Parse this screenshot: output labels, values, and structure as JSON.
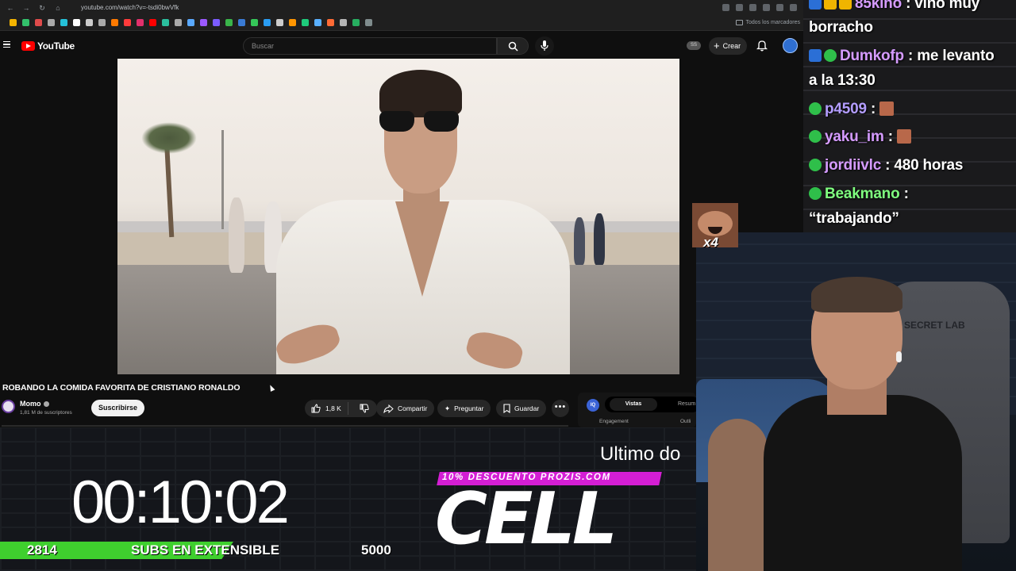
{
  "browser": {
    "url": "youtube.com/watch?v=-tsdi0bwVfk",
    "bookmarks_folder": "Todos los marcadores"
  },
  "youtube": {
    "logo_text": "YouTube",
    "search_placeholder": "Buscar",
    "ss_badge": "SS",
    "create_label": "Crear",
    "video_title": "ROBANDO LA COMIDA FAVORITA DE CRISTIANO RONALDO",
    "channel_name": "Momo",
    "channel_subs": "1,81 M de suscriptores",
    "subscribe_label": "Suscribirse",
    "like_count": "1,8 K",
    "share_label": "Compartir",
    "ask_label": "Preguntar",
    "save_label": "Guardar",
    "more_label": "•••",
    "analytics": {
      "icon_text": "IQ",
      "tab_active": "Vistas",
      "tab_inactive": "Resum",
      "row_left": "Engagement",
      "row_right": "Outli"
    }
  },
  "chat": [
    {
      "user": "85kino",
      "message": " : vino muy",
      "user_color": "#d59bff"
    },
    {
      "user": "",
      "message": "borracho",
      "user_color": "#ffffff"
    },
    {
      "user": "Dumkofp",
      "message": " : me levanto",
      "user_color": "#d59bff"
    },
    {
      "user": "",
      "message": "a la 13:30",
      "user_color": "#ffffff"
    },
    {
      "user": "p4509",
      "message": " : ",
      "user_color": "#b39dff"
    },
    {
      "user": "yaku_im",
      "message": " : ",
      "user_color": "#d59bff"
    },
    {
      "user": "jordiivlc",
      "message": " : 480 horas",
      "user_color": "#d59bff"
    },
    {
      "user": "Beakmano",
      "message": " :",
      "user_color": "#7fff7f"
    },
    {
      "user": "",
      "message": "“trabajando”",
      "user_color": "#ffffff"
    }
  ],
  "gif_overlay": {
    "multiplier": "x4"
  },
  "stream": {
    "timer": "00:10:02",
    "subs_current": "2814",
    "subs_label": "SUBS EN EXTENSIBLE",
    "subs_goal": "5000",
    "subs_progress_fraction": 0.563,
    "ultimo_text": "Ultimo do",
    "promo_text": "10% DESCUENTO PROZIS.COM",
    "brand_text": "CELL"
  },
  "cam": {
    "chair_logo": "SECRET LAB"
  },
  "colors": {
    "youtube_red": "#ff0000",
    "promo_magenta": "#d41ed4",
    "subs_green": "#3fcf2e"
  }
}
